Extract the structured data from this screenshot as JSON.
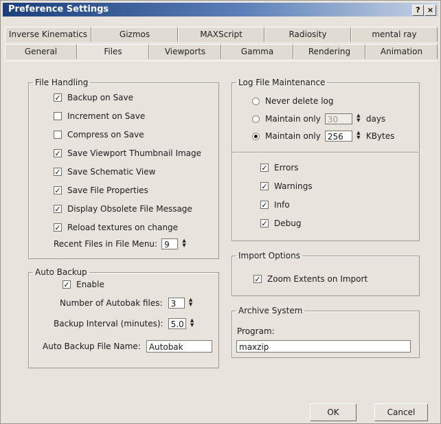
{
  "window": {
    "title": "Preference Settings",
    "help_label": "?",
    "close_label": "×"
  },
  "tabs": {
    "row1": [
      "Inverse Kinematics",
      "Gizmos",
      "MAXScript",
      "Radiosity",
      "mental ray"
    ],
    "row2": [
      "General",
      "Files",
      "Viewports",
      "Gamma",
      "Rendering",
      "Animation"
    ],
    "active": "Files"
  },
  "file_handling": {
    "legend": "File Handling",
    "options": [
      {
        "label": "Backup on Save",
        "checked": true
      },
      {
        "label": "Increment on Save",
        "checked": false
      },
      {
        "label": "Compress on Save",
        "checked": false
      },
      {
        "label": "Save Viewport Thumbnail Image",
        "checked": true
      },
      {
        "label": "Save Schematic View",
        "checked": true
      },
      {
        "label": "Save File Properties",
        "checked": true
      },
      {
        "label": "Display Obsolete File Message",
        "checked": true
      },
      {
        "label": "Reload textures on change",
        "checked": true
      }
    ],
    "recent_label": "Recent Files in File Menu:",
    "recent_value": "9"
  },
  "auto_backup": {
    "legend": "Auto Backup",
    "enable_label": "Enable",
    "enable_checked": true,
    "num_files_label": "Number of Autobak files:",
    "num_files_value": "3",
    "interval_label": "Backup Interval (minutes):",
    "interval_value": "5.0",
    "filename_label": "Auto Backup File Name:",
    "filename_value": "Autobak"
  },
  "log_file": {
    "legend": "Log File Maintenance",
    "never_label": "Never delete log",
    "maintain_label": "Maintain only",
    "days_value": "30",
    "days_unit": "days",
    "kb_value": "256",
    "kb_unit": "KBytes",
    "selected": "kbytes",
    "checks": [
      {
        "label": "Errors",
        "checked": true
      },
      {
        "label": "Warnings",
        "checked": true
      },
      {
        "label": "Info",
        "checked": true
      },
      {
        "label": "Debug",
        "checked": true
      }
    ]
  },
  "import_options": {
    "legend": "Import Options",
    "zoom_label": "Zoom Extents on Import",
    "zoom_checked": true
  },
  "archive": {
    "legend": "Archive System",
    "program_label": "Program:",
    "program_value": "maxzip"
  },
  "buttons": {
    "ok": "OK",
    "cancel": "Cancel"
  },
  "check_glyph": "✓"
}
